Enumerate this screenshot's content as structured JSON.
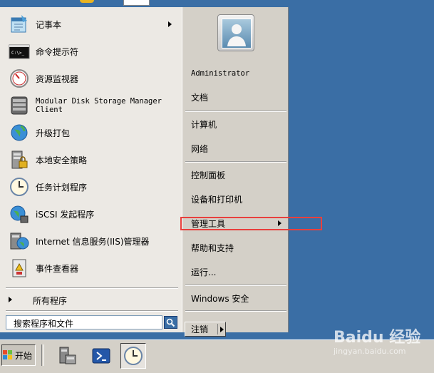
{
  "start_menu": {
    "programs": [
      {
        "label": "记事本",
        "icon": "notepad-icon",
        "submenu": true
      },
      {
        "label": "命令提示符",
        "icon": "cmd-icon",
        "submenu": false
      },
      {
        "label": "资源监视器",
        "icon": "resource-monitor-icon",
        "submenu": false
      },
      {
        "label": "Modular Disk Storage Manager Client",
        "icon": "disk-storage-icon",
        "submenu": false
      },
      {
        "label": "升级打包",
        "icon": "upgrade-globe-icon",
        "submenu": false
      },
      {
        "label": "本地安全策略",
        "icon": "security-policy-icon",
        "submenu": false
      },
      {
        "label": "任务计划程序",
        "icon": "task-scheduler-icon",
        "submenu": false
      },
      {
        "label": "iSCSI 发起程序",
        "icon": "iscsi-icon",
        "submenu": false
      },
      {
        "label": "Internet 信息服务(IIS)管理器",
        "icon": "iis-icon",
        "submenu": false
      },
      {
        "label": "事件查看器",
        "icon": "event-viewer-icon",
        "submenu": false
      }
    ],
    "all_programs": "所有程序",
    "search_placeholder": "搜索程序和文件",
    "right": {
      "user": "Administrator",
      "documents": "文档",
      "computer": "计算机",
      "network": "网络",
      "control_panel": "控制面板",
      "devices_printers": "设备和打印机",
      "admin_tools": "管理工具",
      "help_support": "帮助和支持",
      "run": "运行...",
      "windows_security": "Windows 安全"
    },
    "logout": "注销"
  },
  "taskbar": {
    "start_label": "开始"
  },
  "watermark": {
    "brand": "Baidu 经验",
    "url": "jingyan.baidu.com"
  },
  "colors": {
    "desktop": "#3a6ea5",
    "highlight_box": "#e8403d"
  }
}
